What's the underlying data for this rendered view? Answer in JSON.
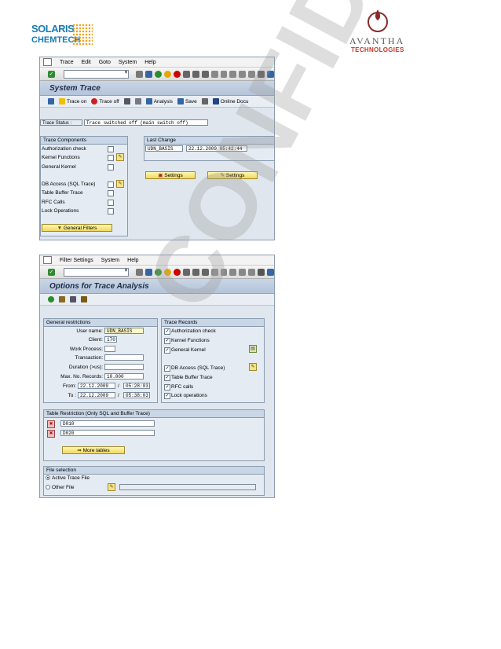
{
  "logos": {
    "left_line1": "SOLARIS",
    "left_line2": "CHEMTECH",
    "right_name": "AVANTHA",
    "right_sub": "TECHNOLOGIES"
  },
  "watermark": "CONFIDENTIAL",
  "win1": {
    "menu": [
      "Trace",
      "Edit",
      "Goto",
      "System",
      "Help"
    ],
    "title": "System Trace",
    "app_toolbar": [
      "Trace on",
      "Trace off",
      "Analysis",
      "Save",
      "Online Docu"
    ],
    "trace_status_label": "Trace Status :",
    "trace_status_value": "Trace switched off (main switch off)",
    "components_header": "Trace Components",
    "components": [
      "Authorization check",
      "Kernel Functions",
      "General Kernel",
      "DB Access (SQL Trace)",
      "Table Buffer Trace",
      "RFC Calls",
      "Lock Operations"
    ],
    "general_filters": "General Filters",
    "last_change_header": "Last Change",
    "last_change_user": "UDN_BASIS",
    "last_change_time": "22.12.2009 05:42:44",
    "settings1": "Settings",
    "settings2": "Settings"
  },
  "win2": {
    "menu": [
      "Filter Settings",
      "System",
      "Help"
    ],
    "title": "Options for Trace Analysis",
    "general_header": "General restrictions",
    "labels": {
      "user": "User name:",
      "client": "Client:",
      "workprocess": "Work Process:",
      "transaction": "Transaction:",
      "duration": "Duration (>us):",
      "maxrec": "Max. No. Records:",
      "from": "From:",
      "to": "To :"
    },
    "values": {
      "user": "UDN_BASIS",
      "client": "170",
      "maxrec": "10.000",
      "from_date": "22.12.2009",
      "from_time": "05:28:03",
      "to_date": "22.12.2009",
      "to_time": "05:38:03",
      "slash": "/"
    },
    "records_header": "Trace Records",
    "records": [
      "Authorization check",
      "Kernel Functions",
      "General Kernel",
      "DB Access (SQL Trace)",
      "Table Buffer Trace",
      "RFC calls",
      "Lock operations"
    ],
    "table_header": "Table Restriction (Only SQL and Buffer Trace)",
    "tables": [
      "D010",
      "D020"
    ],
    "more_tables": "More tables",
    "file_header": "File selection",
    "active_file": "Active Trace File",
    "other_file": "Other File"
  },
  "colors": {
    "sap_bg": "#dfe6ee",
    "title_bg": "#b3c4d9",
    "button_yellow": "#f0d860",
    "solaris_blue": "#1a7ab8",
    "avantha_red": "#c0392b"
  }
}
